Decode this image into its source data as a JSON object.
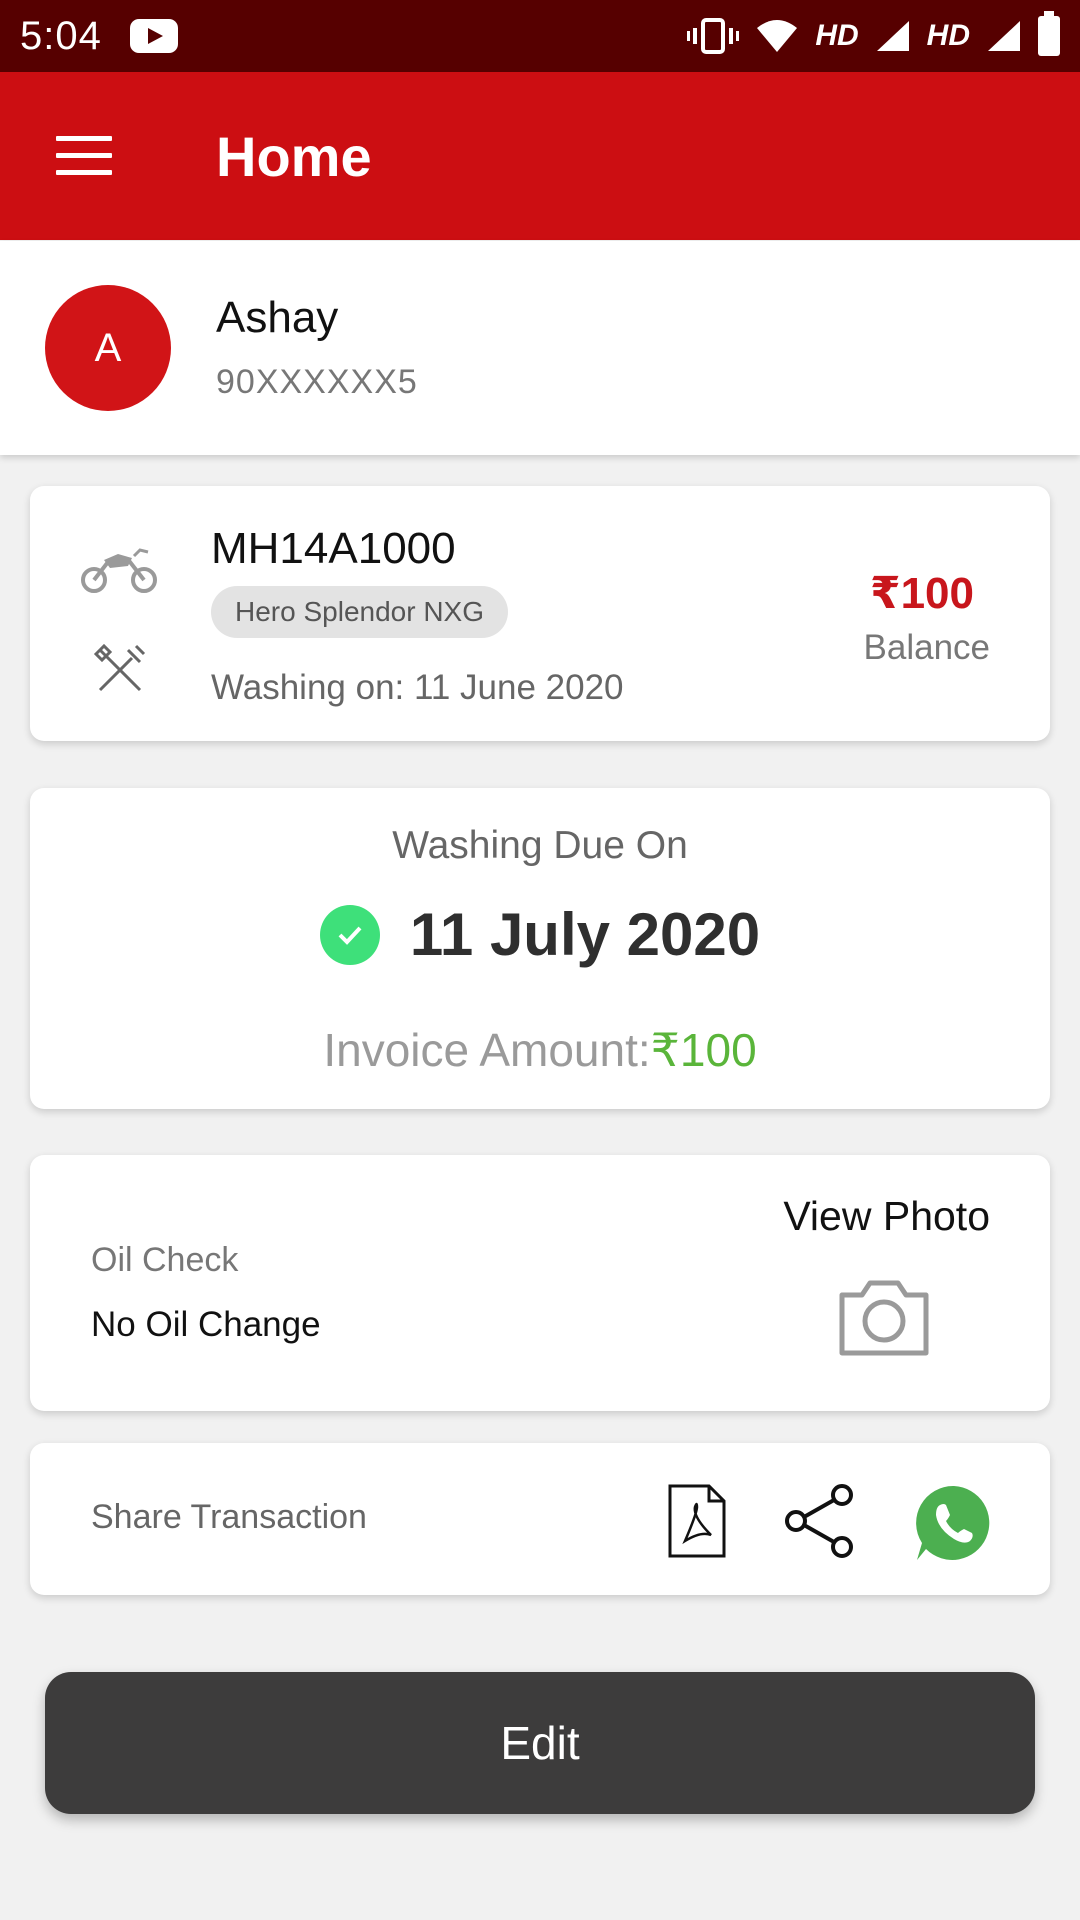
{
  "status_bar": {
    "time": "5:04",
    "hd1": "HD",
    "hd2": "HD"
  },
  "app_bar": {
    "title": "Home"
  },
  "user": {
    "initial": "A",
    "name": "Ashay",
    "phone": "90XXXXXX5"
  },
  "vehicle": {
    "number": "MH14A1000",
    "model": "Hero Splendor NXG",
    "washing_on": "Washing on: 11 June 2020",
    "balance_amount": "₹100",
    "balance_label": "Balance"
  },
  "due": {
    "title": "Washing Due On",
    "date": "11 July 2020",
    "invoice_label": "Invoice Amount:",
    "invoice_amount": "₹100"
  },
  "oil": {
    "label": "Oil Check",
    "value": "No Oil Change",
    "view_photo": "View Photo"
  },
  "share": {
    "label": "Share Transaction"
  },
  "edit_button": {
    "label": "Edit"
  },
  "colors": {
    "status_bar": "#560000",
    "app_bar": "#cc0e12",
    "balance": "#c8161c",
    "check": "#3ee07a",
    "invoice_amount": "#5ab53a",
    "whatsapp": "#4caf50",
    "edit_button": "#3d3c3c"
  },
  "icons": [
    "youtube-icon",
    "vibrate-icon",
    "wifi-icon",
    "signal-icon",
    "battery-icon",
    "menu-icon",
    "bike-icon",
    "tools-icon",
    "check-icon",
    "camera-icon",
    "pdf-icon",
    "share-icon",
    "whatsapp-icon"
  ]
}
